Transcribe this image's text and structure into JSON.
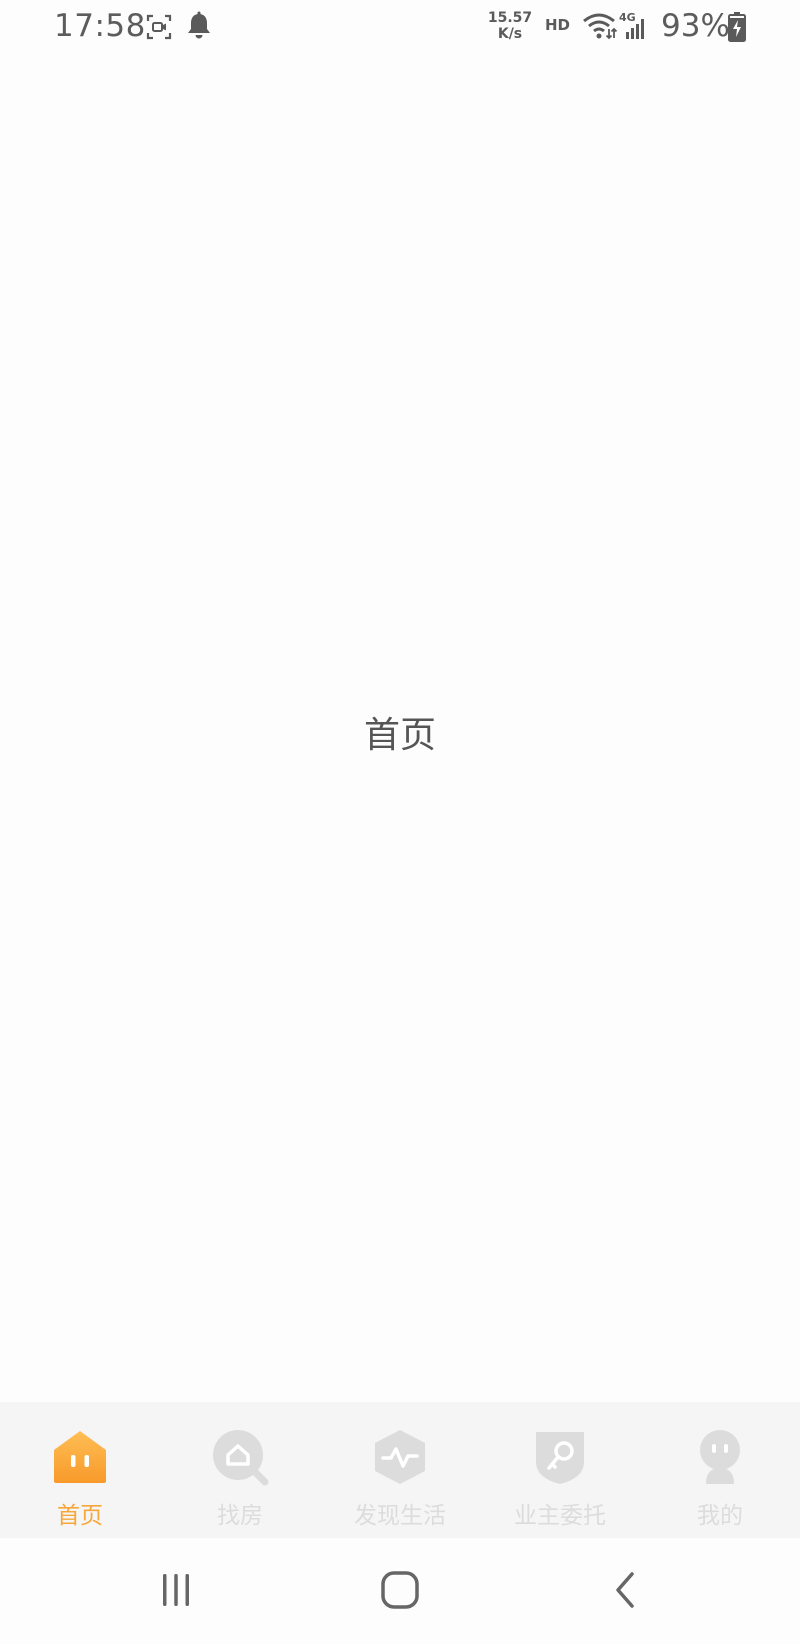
{
  "status_bar": {
    "time": "17:58",
    "icons": [
      "screen-record-icon",
      "notification-bell-icon",
      "wifi-icon",
      "signal-4g-icon",
      "battery-charging-icon"
    ],
    "net_speed_value": "15.57",
    "net_speed_unit": "K/s",
    "hd_label": "HD",
    "network_type": "4G",
    "battery_percent": "93%"
  },
  "main": {
    "title": "首页"
  },
  "tab_bar": {
    "active_color": "#f7a73a",
    "inactive_color": "#dcdcdc",
    "tabs": [
      {
        "label": "首页",
        "icon": "home-icon",
        "active": true
      },
      {
        "label": "找房",
        "icon": "find-house-icon",
        "active": false
      },
      {
        "label": "发现生活",
        "icon": "discover-life-icon",
        "active": false
      },
      {
        "label": "业主委托",
        "icon": "owner-entrust-icon",
        "active": false
      },
      {
        "label": "我的",
        "icon": "profile-icon",
        "active": false
      }
    ]
  },
  "nav_bar": {
    "buttons": [
      "recent-apps-icon",
      "home-button-icon",
      "back-icon"
    ]
  }
}
